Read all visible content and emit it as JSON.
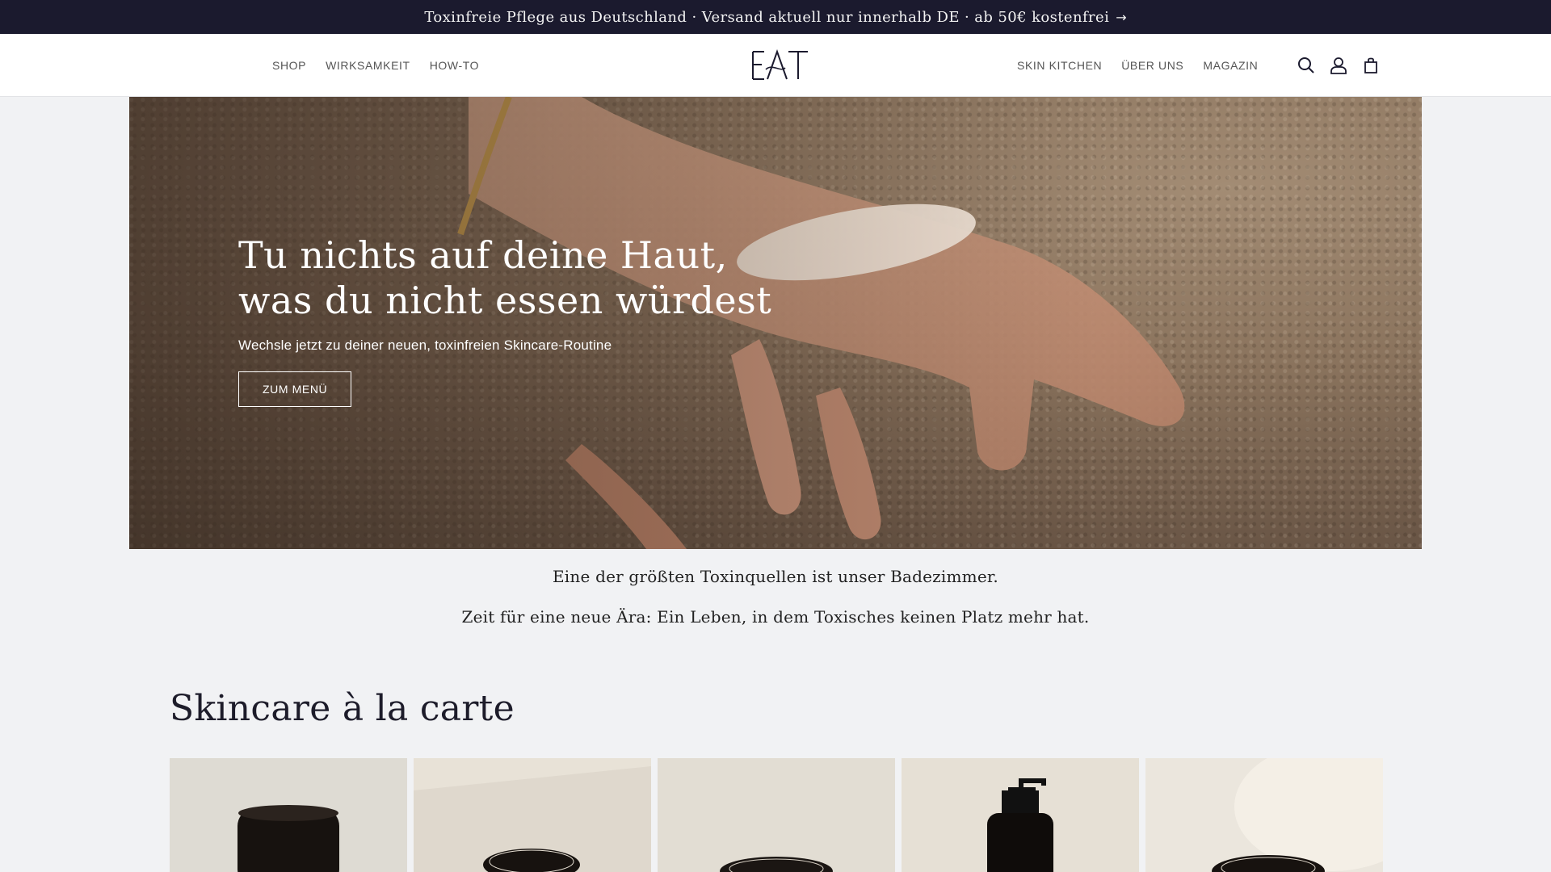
{
  "announcement": {
    "text": "Toxinfreie Pflege aus Deutschland · Versand aktuell nur innerhalb DE · ab 50€ kostenfrei",
    "arrow": "→"
  },
  "header": {
    "nav_left": [
      "SHOP",
      "WIRKSAMKEIT",
      "HOW-TO"
    ],
    "nav_right": [
      "SKIN KITCHEN",
      "ÜBER UNS",
      "MAGAZIN"
    ],
    "logo_text": "EAT",
    "icons": [
      "search-icon",
      "account-icon",
      "cart-icon"
    ]
  },
  "hero": {
    "title_line1": "Tu nichts auf deine Haut,",
    "title_line2": "was du nicht essen würdest",
    "subtitle": "Wechsle jetzt zu deiner neuen, toxinfreien Skincare-Routine",
    "button_label": "ZUM MENÜ"
  },
  "quotes": [
    "Eine der größten Toxinquellen ist unser Badezimmer.",
    "Zeit für eine neue Ära: Ein Leben, in dem Toxisches keinen Platz mehr hat."
  ],
  "section": {
    "title": "Skincare à la carte"
  },
  "colors": {
    "announcement_bg": "#1b1a2e",
    "page_bg": "#f1f2f4",
    "header_bg": "#ffffff",
    "title_color": "#1d1c2a"
  }
}
